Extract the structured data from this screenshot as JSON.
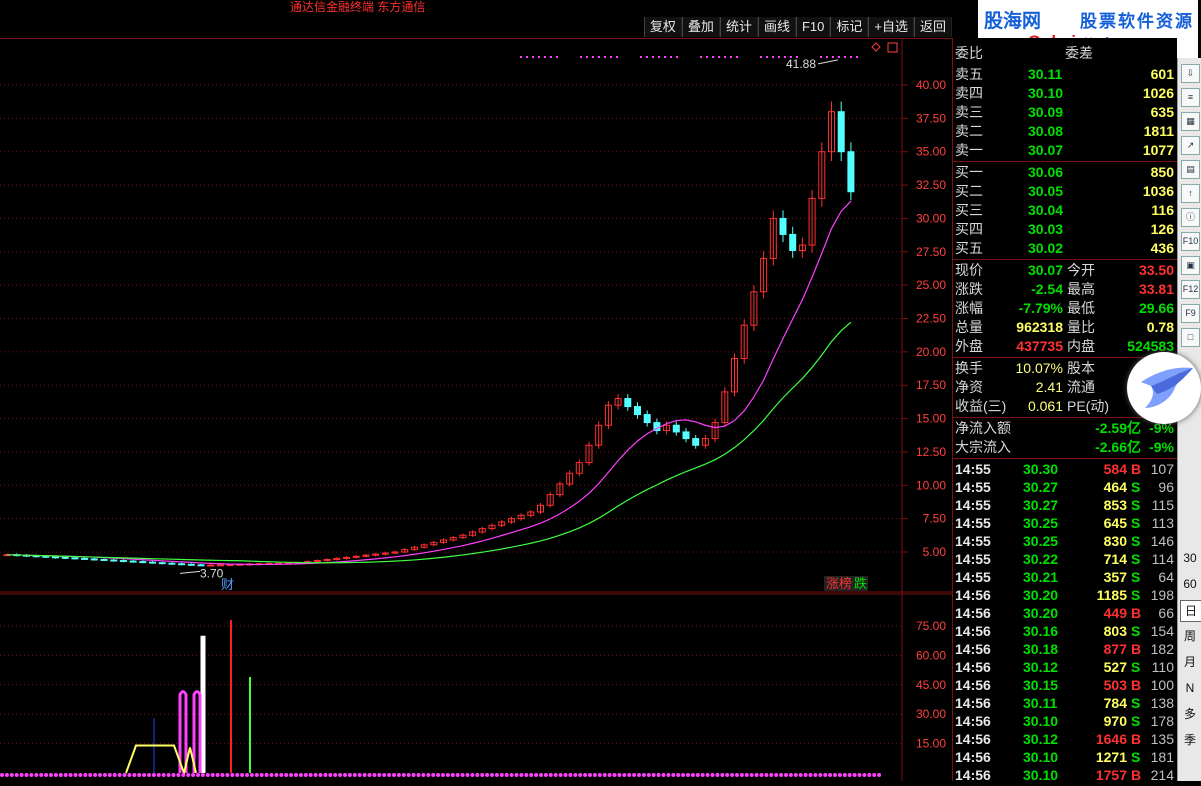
{
  "window": {
    "title": "通达信金融终端  东方通信"
  },
  "toolbar": {
    "buttons": [
      "复权",
      "叠加",
      "统计",
      "画线",
      "F10",
      "标记",
      "+自选",
      "返回"
    ]
  },
  "logo": {
    "site": "股海网",
    "tagline": "股票软件资源分享",
    "url": "www.Guhai.com.cn"
  },
  "main_chart": {
    "y_ticks": [
      "40.00",
      "37.50",
      "35.00",
      "32.50",
      "30.00",
      "27.50",
      "25.00",
      "22.50",
      "20.00",
      "17.50",
      "15.00",
      "12.50",
      "10.00",
      "7.50",
      "5.00"
    ],
    "high_label": "41.88",
    "low_label": "3.70",
    "fin_marker": "财",
    "badge_left": "涨榜",
    "badge_right": "跌"
  },
  "sub_chart": {
    "y_ticks": [
      "75.00",
      "60.00",
      "45.00",
      "30.00",
      "15.00"
    ]
  },
  "chart_data": {
    "type": "candlestick",
    "ylim": [
      3.7,
      41.88
    ],
    "high": 41.88,
    "low": 3.7,
    "last_close": 30.07,
    "ma_fast_end": 30.5,
    "ma_slow_end": 27.3
  },
  "quote": {
    "header_label": "委比",
    "header_label2": "委差",
    "asks": [
      {
        "label": "卖五",
        "price": "30.11",
        "vol": "601"
      },
      {
        "label": "卖四",
        "price": "30.10",
        "vol": "1026"
      },
      {
        "label": "卖三",
        "price": "30.09",
        "vol": "635"
      },
      {
        "label": "卖二",
        "price": "30.08",
        "vol": "1811"
      },
      {
        "label": "卖一",
        "price": "30.07",
        "vol": "1077"
      }
    ],
    "bids": [
      {
        "label": "买一",
        "price": "30.06",
        "vol": "850"
      },
      {
        "label": "买二",
        "price": "30.05",
        "vol": "1036"
      },
      {
        "label": "买三",
        "price": "30.04",
        "vol": "116"
      },
      {
        "label": "买四",
        "price": "30.03",
        "vol": "126"
      },
      {
        "label": "买五",
        "price": "30.02",
        "vol": "436"
      }
    ],
    "stats": [
      {
        "l1": "现价",
        "v1": "30.07",
        "l2": "今开",
        "v2": "33.50"
      },
      {
        "l1": "涨跌",
        "v1": "-2.54",
        "l2": "最高",
        "v2": "33.81"
      },
      {
        "l1": "涨幅",
        "v1": "-7.79%",
        "l2": "最低",
        "v2": "29.66"
      },
      {
        "l1": "总量",
        "v1": "962318",
        "l2": "量比",
        "v2": "0.78"
      },
      {
        "l1": "外盘",
        "v1": "437735",
        "l2": "内盘",
        "v2": "524583"
      }
    ],
    "stats2": [
      {
        "l1": "换手",
        "v1": "10.07%",
        "l2": "股本",
        "v2": "1"
      },
      {
        "l1": "净资",
        "v1": "2.41",
        "l2": "流通",
        "v2": ""
      },
      {
        "l1": "收益(三)",
        "v1": "0.061",
        "l2": "PE(动)",
        "v2": ""
      }
    ],
    "flows": [
      {
        "label": "净流入额",
        "value": "-2.59亿",
        "pct": "-9%"
      },
      {
        "label": "大宗流入",
        "value": "-2.66亿",
        "pct": "-9%"
      }
    ],
    "ticks": [
      {
        "t": "14:55",
        "p": "30.30",
        "v": "584",
        "d": "B",
        "n": "107"
      },
      {
        "t": "14:55",
        "p": "30.27",
        "v": "464",
        "d": "S",
        "n": "96"
      },
      {
        "t": "14:55",
        "p": "30.27",
        "v": "853",
        "d": "S",
        "n": "115"
      },
      {
        "t": "14:55",
        "p": "30.25",
        "v": "645",
        "d": "S",
        "n": "113"
      },
      {
        "t": "14:55",
        "p": "30.25",
        "v": "830",
        "d": "S",
        "n": "146"
      },
      {
        "t": "14:55",
        "p": "30.22",
        "v": "714",
        "d": "S",
        "n": "114"
      },
      {
        "t": "14:55",
        "p": "30.21",
        "v": "357",
        "d": "S",
        "n": "64"
      },
      {
        "t": "14:56",
        "p": "30.20",
        "v": "1185",
        "d": "S",
        "n": "198"
      },
      {
        "t": "14:56",
        "p": "30.20",
        "v": "449",
        "d": "B",
        "n": "66"
      },
      {
        "t": "14:56",
        "p": "30.16",
        "v": "803",
        "d": "S",
        "n": "154"
      },
      {
        "t": "14:56",
        "p": "30.18",
        "v": "877",
        "d": "B",
        "n": "182"
      },
      {
        "t": "14:56",
        "p": "30.12",
        "v": "527",
        "d": "S",
        "n": "110"
      },
      {
        "t": "14:56",
        "p": "30.15",
        "v": "503",
        "d": "B",
        "n": "100"
      },
      {
        "t": "14:56",
        "p": "30.11",
        "v": "784",
        "d": "S",
        "n": "138"
      },
      {
        "t": "14:56",
        "p": "30.10",
        "v": "970",
        "d": "S",
        "n": "178"
      },
      {
        "t": "14:56",
        "p": "30.12",
        "v": "1646",
        "d": "B",
        "n": "135"
      },
      {
        "t": "14:56",
        "p": "30.10",
        "v": "1271",
        "d": "S",
        "n": "181"
      },
      {
        "t": "14:56",
        "p": "30.10",
        "v": "1757",
        "d": "B",
        "n": "214"
      }
    ]
  },
  "periods": [
    "30",
    "60",
    "日",
    "周",
    "月",
    "N",
    "多",
    "季"
  ],
  "colors": {
    "up": "#ff3030",
    "down": "#54ffff",
    "ma1": "#ff40ff",
    "ma2": "#40ff40",
    "grid": "#7a1010",
    "price_green": "#00e000",
    "price_red": "#ff3030",
    "vol_yellow": "#ffff40"
  }
}
